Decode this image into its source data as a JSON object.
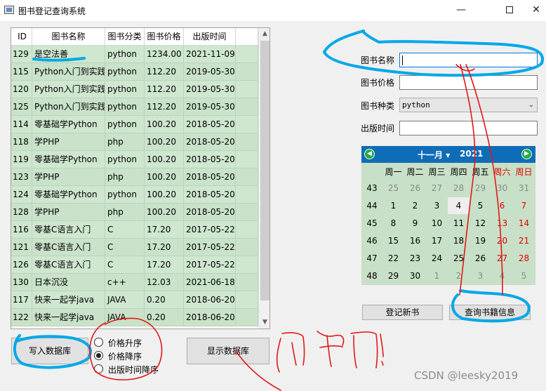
{
  "window": {
    "title": "图书登记查询系统",
    "minimize": "—",
    "close": "✕"
  },
  "table": {
    "columns": [
      "ID",
      "图书名称",
      "图书分类",
      "图书价格",
      "出版时间"
    ],
    "rows": [
      {
        "id": "129",
        "name": "是空法善",
        "category": "python",
        "price": "1234.00",
        "date": "2021-11-09"
      },
      {
        "id": "115",
        "name": "Python入门到实践",
        "category": "python",
        "price": "112.20",
        "date": "2019-05-30"
      },
      {
        "id": "120",
        "name": "Python入门到实践",
        "category": "python",
        "price": "112.20",
        "date": "2019-05-30"
      },
      {
        "id": "125",
        "name": "Python入门到实践",
        "category": "python",
        "price": "112.20",
        "date": "2019-05-30"
      },
      {
        "id": "114",
        "name": "零基础学Python",
        "category": "python",
        "price": "100.20",
        "date": "2018-05-20"
      },
      {
        "id": "118",
        "name": "学PHP",
        "category": "php",
        "price": "100.20",
        "date": "2018-05-20"
      },
      {
        "id": "119",
        "name": "零基础学Python",
        "category": "python",
        "price": "100.20",
        "date": "2018-05-20"
      },
      {
        "id": "123",
        "name": "学PHP",
        "category": "php",
        "price": "100.20",
        "date": "2018-05-20"
      },
      {
        "id": "124",
        "name": "零基础学Python",
        "category": "python",
        "price": "100.20",
        "date": "2018-05-20"
      },
      {
        "id": "128",
        "name": "学PHP",
        "category": "php",
        "price": "100.20",
        "date": "2018-05-20"
      },
      {
        "id": "116",
        "name": "零基C语言入门",
        "category": "C",
        "price": "17.20",
        "date": "2017-05-22"
      },
      {
        "id": "121",
        "name": "零基C语言入门",
        "category": "C",
        "price": "17.20",
        "date": "2017-05-22"
      },
      {
        "id": "126",
        "name": "零基C语言入门",
        "category": "C",
        "price": "17.20",
        "date": "2017-05-22"
      },
      {
        "id": "130",
        "name": "日本沉没",
        "category": "c++",
        "price": "12.03",
        "date": "2021-06-18"
      },
      {
        "id": "117",
        "name": "快来一起学java",
        "category": "JAVA",
        "price": "0.20",
        "date": "2018-06-20"
      },
      {
        "id": "122",
        "name": "快来一起学java",
        "category": "JAVA",
        "price": "0.20",
        "date": "2018-06-20"
      }
    ]
  },
  "form": {
    "name_label": "图书名称",
    "name_value": "",
    "price_label": "图书价格",
    "price_value": "",
    "type_label": "图书种类",
    "type_value": "python",
    "date_label": "出版时间",
    "date_value": ""
  },
  "calendar": {
    "month": "十一月",
    "year": "2021",
    "weekdays": [
      "周一",
      "周二",
      "周三",
      "周四",
      "周五",
      "周六",
      "周日"
    ],
    "weeks": [
      {
        "week": "43",
        "days": [
          "25",
          "26",
          "27",
          "28",
          "29",
          "30",
          "31"
        ]
      },
      {
        "week": "44",
        "days": [
          "1",
          "2",
          "3",
          "4",
          "5",
          "6",
          "7"
        ]
      },
      {
        "week": "45",
        "days": [
          "8",
          "9",
          "10",
          "11",
          "12",
          "13",
          "14"
        ]
      },
      {
        "week": "46",
        "days": [
          "15",
          "16",
          "17",
          "18",
          "19",
          "20",
          "21"
        ]
      },
      {
        "week": "47",
        "days": [
          "22",
          "23",
          "24",
          "25",
          "26",
          "27",
          "28"
        ]
      },
      {
        "week": "48",
        "days": [
          "29",
          "30",
          "1",
          "2",
          "3",
          "4",
          "5"
        ]
      }
    ],
    "selected_day": "4",
    "colors": {
      "header": "#0f6db8",
      "weekend": "#e00000",
      "background": "#c7e0c7"
    }
  },
  "buttons": {
    "register": "登记新书",
    "query": "查询书籍信息",
    "write_db": "写入数据库",
    "show_db": "显示数据库"
  },
  "sort_options": [
    {
      "label": "价格升序",
      "checked": false
    },
    {
      "label": "价格降序",
      "checked": true
    },
    {
      "label": "出版时间降序",
      "checked": false
    }
  ],
  "annotation": {
    "text": "没用!",
    "color": "#e01818",
    "highlight_color": "#00a8e8"
  },
  "watermark": "CSDN @leesky2019"
}
